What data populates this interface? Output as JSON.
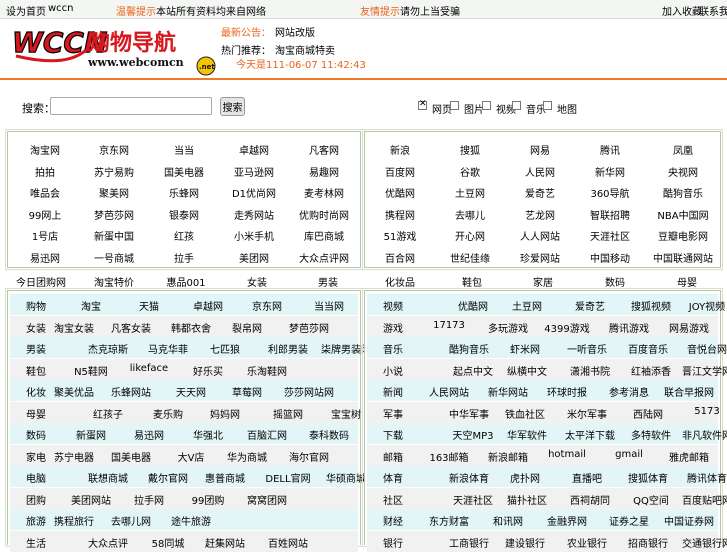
{
  "topbar": {
    "left_label": "设为首页",
    "site_code": "wccn",
    "notice_prefix": "温馨提示",
    "notice_text": "本站所有资料均来自网络",
    "notice2_prefix": "友情提示",
    "notice2_text": "请勿上当受骗",
    "right_links": [
      "加入收藏",
      "联系我们"
    ]
  },
  "header": {
    "logo_text": "WCCN",
    "logo_cn": "购物导航",
    "logo_url": "www.webcomcn",
    "logo_badge": ".net",
    "row1_label": "最新公告：",
    "row1_value": "网站改版",
    "row2_label": "热门推荐：",
    "row2_value": "淘宝商城特卖",
    "clock_text": "今天是111-06-07 11:42:43"
  },
  "search": {
    "label": "搜索：",
    "input_value": "",
    "button_label": "搜索",
    "options": [
      {
        "label": "网页",
        "checked": true
      },
      {
        "label": "图片",
        "checked": false
      },
      {
        "label": "视频",
        "checked": false
      },
      {
        "label": "音乐",
        "checked": false
      },
      {
        "label": "地图",
        "checked": false
      }
    ]
  },
  "grid_left": [
    [
      "淘宝网",
      "京东网",
      "当当",
      "卓越网",
      "凡客网"
    ],
    [
      "拍拍",
      "苏宁易购",
      "国美电器",
      "亚马逊网",
      "易趣网"
    ],
    [
      "唯品会",
      "聚美网",
      "乐蜂网",
      "D1优尚网",
      "麦考林网"
    ],
    [
      "99网上",
      "梦芭莎网",
      "银泰网",
      "走秀网站",
      "优购时尚网"
    ],
    [
      "1号店",
      "新蛋中国",
      "红孩",
      "小米手机",
      "库巴商城"
    ],
    [
      "易迅网",
      "一号商城",
      "拉手",
      "美团网",
      "大众点评网"
    ]
  ],
  "grid_right": [
    [
      "新浪",
      "搜狐",
      "网易",
      "腾讯",
      "凤凰"
    ],
    [
      "百度网",
      "谷歌",
      "人民网",
      "新华网",
      "央视网"
    ],
    [
      "优酷网",
      "土豆网",
      "爱奇艺",
      "360导航",
      "酷狗音乐"
    ],
    [
      "携程网",
      "去哪儿",
      "艺龙网",
      "智联招聘",
      "NBA中国网"
    ],
    [
      "51游戏",
      "开心网",
      "人人网站",
      "天涯社区",
      "豆瓣电影网"
    ],
    [
      "百合网",
      "世纪佳缘",
      "珍爱网站",
      "中国移动",
      "中国联通网站"
    ]
  ],
  "middle_row": [
    "今日团购网",
    "淘宝特价",
    "惠品001",
    "女装",
    "男装",
    "化妆品",
    "鞋包",
    "家居",
    "数码",
    "母婴"
  ],
  "cat_left": [
    {
      "label": "购物",
      "items": [
        "淘宝",
        "天猫",
        "卓越网",
        "京东网",
        "当当网"
      ]
    },
    {
      "label": "女装",
      "items": [
        "淘宝女装",
        "凡客女装",
        "韩都衣舍",
        "裂帛网",
        "梦芭莎网"
      ]
    },
    {
      "label": "男装",
      "items": [
        "杰克琼斯",
        "马克华菲",
        "七匹狼",
        "利郎男装",
        "柒牌男装网"
      ]
    },
    {
      "label": "鞋包",
      "items": [
        "N5鞋网",
        "likeface",
        "好乐买",
        "乐淘鞋网"
      ]
    },
    {
      "label": "化妆",
      "items": [
        "聚美优品",
        "乐蜂网站",
        "天天网",
        "草莓网",
        "莎莎网站网"
      ]
    },
    {
      "label": "母婴",
      "items": [
        "红孩子",
        "麦乐购",
        "妈妈网",
        "摇篮网",
        "宝宝树"
      ]
    },
    {
      "label": "数码",
      "items": [
        "新蛋网",
        "易迅网",
        "华强北",
        "百脑汇网",
        "泰科数码"
      ]
    },
    {
      "label": "家电",
      "items": [
        "苏宁电器",
        "国美电器",
        "大V店",
        "华为商城",
        "海尔官网"
      ]
    },
    {
      "label": "电脑",
      "items": [
        "联想商城",
        "戴尔官网",
        "惠普商城",
        "DELL官网",
        "华硕商城"
      ]
    },
    {
      "label": "团购",
      "items": [
        "美团网站",
        "拉手网",
        "99团购",
        "窝窝团网"
      ]
    },
    {
      "label": "旅游",
      "items": [
        "携程旅行",
        "去哪儿网",
        "途牛旅游"
      ]
    },
    {
      "label": "生活",
      "items": [
        "大众点评",
        "58同城",
        "赶集网站",
        "百姓网站"
      ]
    }
  ],
  "cat_right": [
    {
      "label": "视频",
      "items": [
        "优酷网",
        "土豆网",
        "爱奇艺",
        "搜狐视频",
        "JOY视频"
      ]
    },
    {
      "label": "游戏",
      "items": [
        "17173",
        "多玩游戏",
        "4399游戏",
        "腾讯游戏",
        "网易游戏"
      ]
    },
    {
      "label": "音乐",
      "items": [
        "酷狗音乐",
        "虾米网",
        "一听音乐",
        "百度音乐",
        "音悦台网"
      ]
    },
    {
      "label": "小说",
      "items": [
        "起点中文",
        "纵横中文",
        "潇湘书院",
        "红袖添香",
        "晋江文学网"
      ]
    },
    {
      "label": "新闻",
      "items": [
        "人民网站",
        "新华网站",
        "环球时报",
        "参考消息",
        "联合早报网"
      ]
    },
    {
      "label": "军事",
      "items": [
        "中华军事",
        "铁血社区",
        "米尔军事",
        "西陆网",
        "5173"
      ]
    },
    {
      "label": "下载",
      "items": [
        "天空MP3",
        "华军软件",
        "太平洋下载",
        "多特软件",
        "非凡软件网"
      ]
    },
    {
      "label": "邮箱",
      "items": [
        "163邮箱",
        "新浪邮箱",
        "hotmail",
        "gmail",
        "雅虎邮箱"
      ]
    },
    {
      "label": "体育",
      "items": [
        "新浪体育",
        "虎扑网",
        "直播吧",
        "搜狐体育",
        "腾讯体育"
      ]
    },
    {
      "label": "社区",
      "items": [
        "天涯社区",
        "猫扑社区",
        "西祠胡同",
        "QQ空间",
        "百度贴吧网"
      ]
    },
    {
      "label": "财经",
      "items": [
        "东方财富",
        "和讯网",
        "金融界网",
        "证券之星",
        "中国证券网"
      ]
    },
    {
      "label": "银行",
      "items": [
        "工商银行",
        "建设银行",
        "农业银行",
        "招商银行",
        "交通银行网"
      ]
    }
  ]
}
